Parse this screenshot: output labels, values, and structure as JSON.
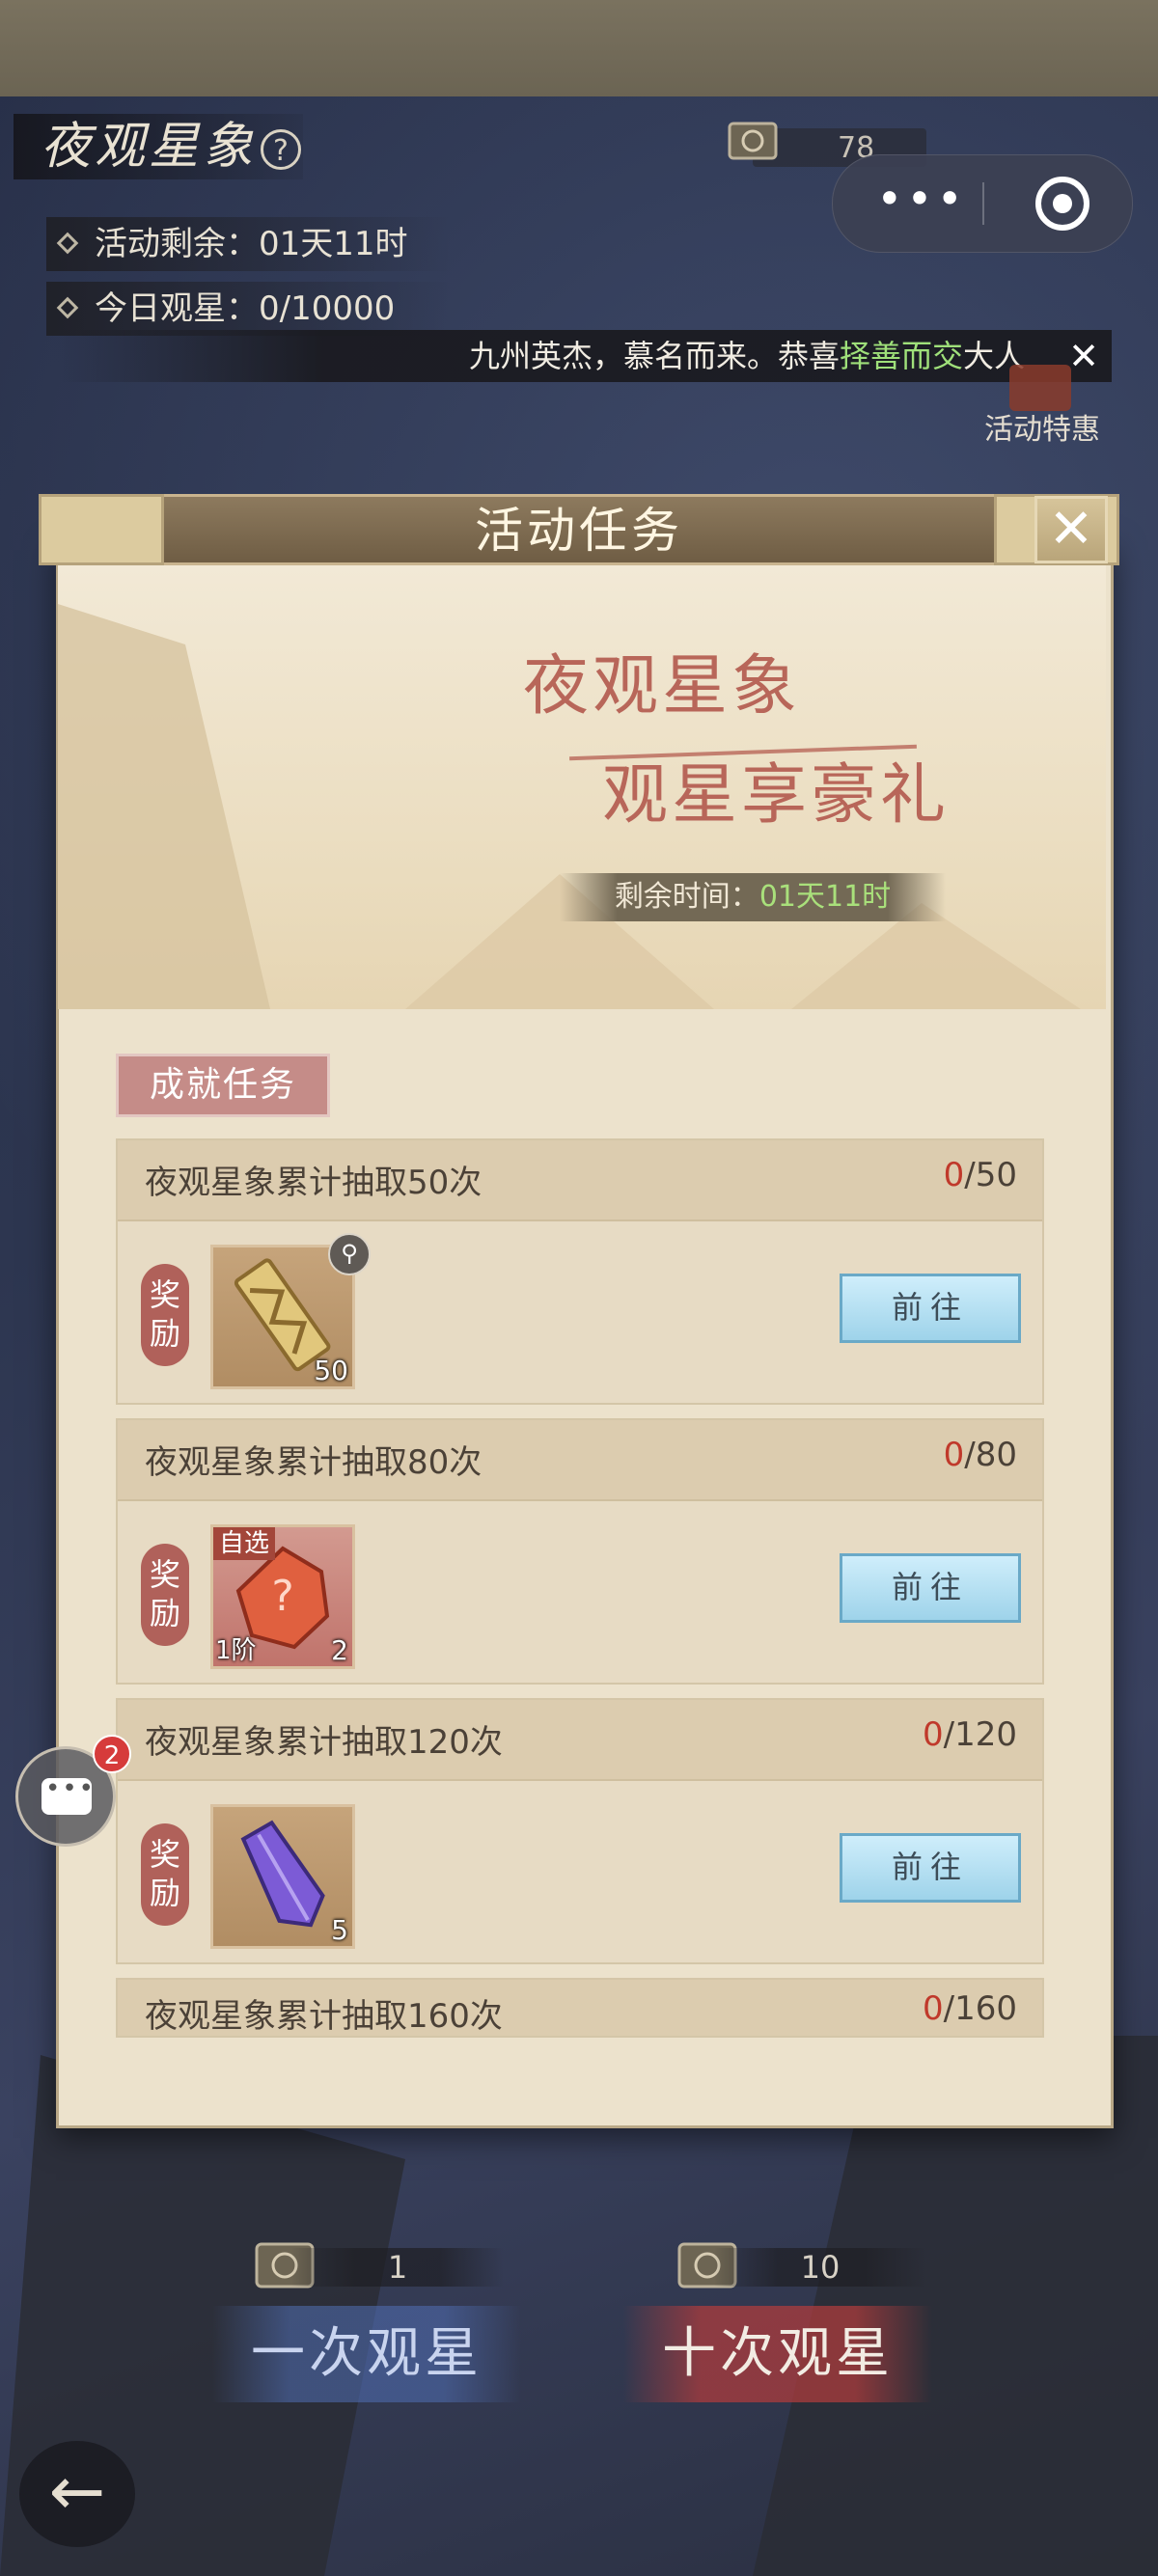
{
  "header": {
    "title": "夜观星象",
    "remaining_label": "活动剩余：",
    "remaining_value": "01天11时",
    "today_label": "今日观星：",
    "today_value": "0/10000",
    "coin_count": "78",
    "help_icon": "question-circle-icon"
  },
  "notice": {
    "text_before": "九州英杰，慕名而来。恭喜",
    "highlight": "择善而交",
    "text_after": "大人",
    "close_symbol": "✕",
    "highlight_color": "#9fe07a"
  },
  "side": {
    "special_offer_label": "活动特惠"
  },
  "panel": {
    "title": "活动任务",
    "close_symbol": "✕",
    "hero_line1": "夜观星象",
    "hero_line2": "观星享豪礼",
    "remain_label": "剩余时间：",
    "remain_value": "01天11时",
    "section_label": "成就任务",
    "tasks": [
      {
        "name": "夜观星象累计抽取50次",
        "current": "0",
        "target": "/50",
        "reward_label": "奖励",
        "item_icon": "golden-token-icon",
        "item_count": "50",
        "button": "前往"
      },
      {
        "name": "夜观星象累计抽取80次",
        "current": "0",
        "target": "/80",
        "reward_label": "奖励",
        "item_icon": "mystery-gem-icon",
        "item_corner": "自选",
        "item_tier": "1阶",
        "item_count": "2",
        "button": "前往"
      },
      {
        "name": "夜观星象累计抽取120次",
        "current": "0",
        "target": "/120",
        "reward_label": "奖励",
        "item_icon": "purple-crystal-icon",
        "item_count": "5",
        "button": "前往"
      },
      {
        "name": "夜观星象累计抽取160次",
        "current": "0",
        "target": "/160"
      }
    ]
  },
  "chat": {
    "badge": "2"
  },
  "draws": {
    "single_cost": "1",
    "single_label": "一次观星",
    "ten_cost": "10",
    "ten_label": "十次观星"
  },
  "nav": {
    "back_symbol": "←"
  },
  "colors": {
    "accent_red": "#c0392b",
    "button_blue": "#9ed3ea"
  }
}
